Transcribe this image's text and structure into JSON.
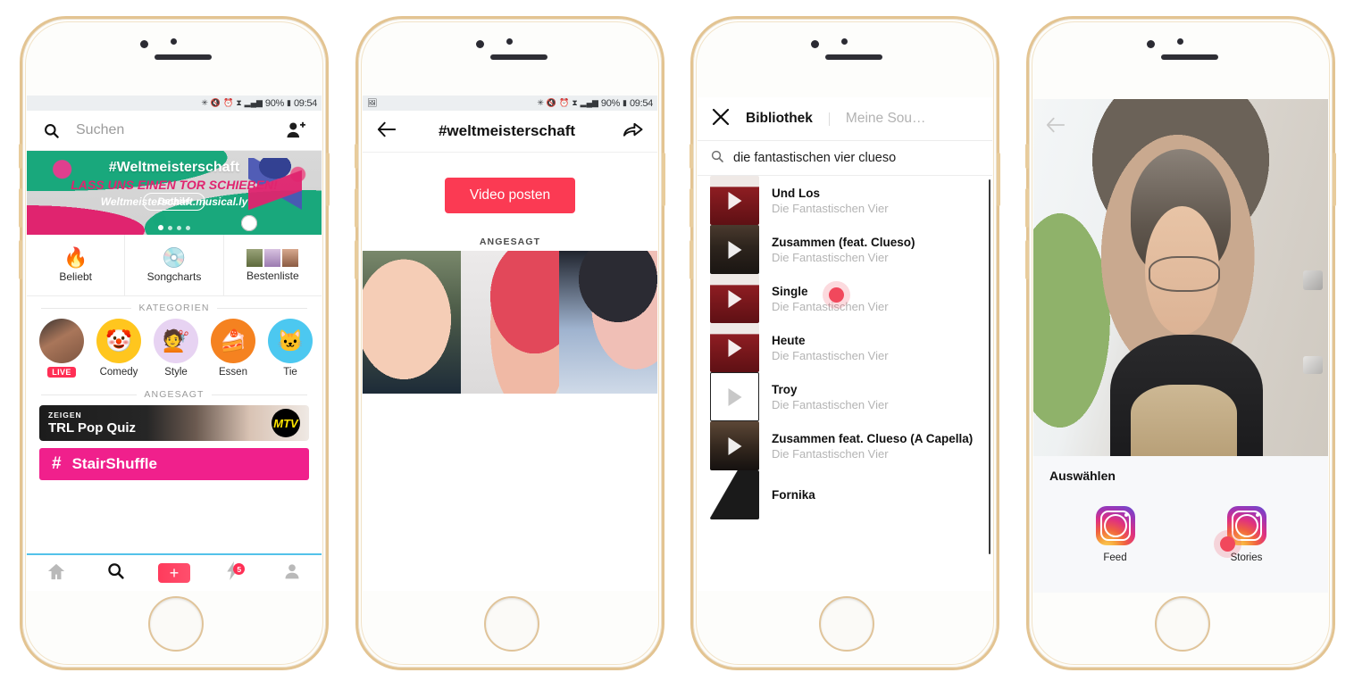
{
  "meta": {
    "colors": {
      "accent_pink": "#f0208c",
      "accent_red": "#fb3a53",
      "tab_border_blue": "#53c2ea",
      "tap_dot": "#f1485c",
      "frame_gold": "#e3c492"
    }
  },
  "status_bar": {
    "icons": [
      "bluetooth-icon",
      "mute-icon",
      "alarm-icon",
      "vpn-icon",
      "signal-icon"
    ],
    "battery": "90%",
    "time": "09:54",
    "left_icon": "screenshot-icon"
  },
  "phone1": {
    "search": {
      "placeholder": "Suchen",
      "icon": "search-icon",
      "add_friend_icon": "add-person-icon"
    },
    "banner": {
      "line1": "#Weltmeisterschaft",
      "line2": "LASS UNS EINEN TOR SCHIEBEN!",
      "line3": "Weltmeisterschaft.musical.ly",
      "details_label": "Details",
      "dots": 4,
      "active_dot": 0
    },
    "quick_tiles": [
      {
        "label": "Beliebt",
        "icon": "fire-emoji",
        "glyph": "🔥"
      },
      {
        "label": "Songcharts",
        "icon": "vinyl-record-emoji",
        "glyph": "💿"
      },
      {
        "label": "Bestenliste",
        "icon": "leaderboard-thumbnails",
        "glyph": ""
      }
    ],
    "section_categories": "KATEGORIEN",
    "categories": [
      {
        "label": "LIVE",
        "icon": "live-avatar",
        "glyph": "",
        "is_live": true,
        "color": "#8a6a58"
      },
      {
        "label": "Comedy",
        "icon": "clown-emoji",
        "glyph": "🤡",
        "color": "#ffc61e"
      },
      {
        "label": "Style",
        "icon": "hairstyle-emoji",
        "glyph": "💇",
        "color": "#e7d3f2"
      },
      {
        "label": "Essen",
        "icon": "cake-emoji",
        "glyph": "🍰",
        "color": "#f58220"
      },
      {
        "label": "Tie",
        "icon": "animal-emoji",
        "glyph": "🐱",
        "color": "#4cc8f0"
      }
    ],
    "section_trending": "ANGESAGT",
    "show_card": {
      "kicker": "ZEIGEN",
      "title": "TRL Pop Quiz",
      "logo": "mtv-logo",
      "logo_text": "MTV"
    },
    "hashtag_banner": {
      "hash": "#",
      "label": "StairShuffle"
    },
    "tabbar": [
      {
        "name": "home",
        "icon": "home-icon",
        "active": false
      },
      {
        "name": "discover",
        "icon": "search-icon",
        "active": true
      },
      {
        "name": "create",
        "icon": "plus-icon",
        "active": false
      },
      {
        "name": "activity",
        "icon": "lightning-bolt-icon",
        "badge": "5"
      },
      {
        "name": "profile",
        "icon": "person-icon",
        "active": false
      }
    ]
  },
  "phone2": {
    "appbar": {
      "back_icon": "back-arrow-icon",
      "title": "#weltmeisterschaft",
      "share_icon": "share-arrow-icon"
    },
    "post_button": "Video posten",
    "section_trending": "ANGESAGT",
    "thumbnails": [
      "video-thumb-1",
      "video-thumb-2",
      "video-thumb-3"
    ]
  },
  "phone3": {
    "header": {
      "close_icon": "close-x-icon",
      "tab_library": "Bibliothek",
      "tab_my_sounds": "Meine Sou…"
    },
    "search": {
      "icon": "search-icon",
      "value": "die fantastischen vier clueso"
    },
    "songs": [
      {
        "title": "Und Los",
        "artist": "Die Fantastischen Vier",
        "cover": "cover-red"
      },
      {
        "title": "Zusammen (feat. Clueso)",
        "artist": "Die Fantastischen Vier",
        "cover": "cover-dark"
      },
      {
        "title": "Single",
        "artist": "Die Fantastischen Vier",
        "cover": "cover-red"
      },
      {
        "title": "Heute",
        "artist": "Die Fantastischen Vier",
        "cover": "cover-red"
      },
      {
        "title": "Troy",
        "artist": "Die Fantastischen Vier",
        "cover": "cover-white"
      },
      {
        "title": "Zusammen feat. Clueso (A Capella)",
        "artist": "Die Fantastischen Vier",
        "cover": "cover-zusammen"
      },
      {
        "title": "Fornika",
        "artist": "",
        "cover": "cover-cow"
      }
    ],
    "tap_target": "Zusammen (feat. Clueso)"
  },
  "phone4": {
    "photo": {
      "back_icon": "back-arrow-icon",
      "alt": "selfie-video-preview"
    },
    "sheet_title": "Auswählen",
    "options": [
      {
        "label": "Feed",
        "icon": "instagram-logo-icon"
      },
      {
        "label": "Stories",
        "icon": "instagram-logo-icon"
      }
    ],
    "tap_target": "Stories"
  }
}
